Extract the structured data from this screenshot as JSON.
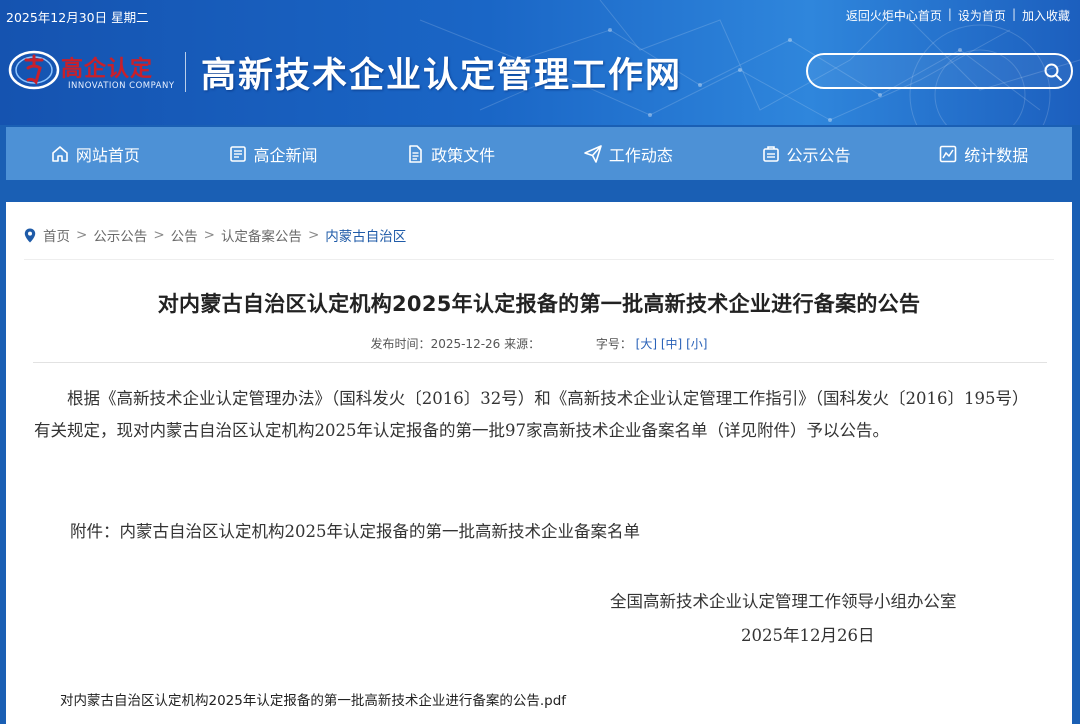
{
  "topbar": {
    "date": "2025年12月30日 星期二",
    "links": [
      "返回火炬中心首页",
      "设为首页",
      "加入收藏"
    ]
  },
  "logo": {
    "cn": "高企认定",
    "en": "INNOVATION COMPANY"
  },
  "site_title": "高新技术企业认定管理工作网",
  "search": {
    "placeholder": "",
    "value": ""
  },
  "nav": [
    {
      "label": "网站首页",
      "icon": "home-icon"
    },
    {
      "label": "高企新闻",
      "icon": "news-icon"
    },
    {
      "label": "政策文件",
      "icon": "document-icon"
    },
    {
      "label": "工作动态",
      "icon": "paper-plane-icon"
    },
    {
      "label": "公示公告",
      "icon": "announcement-icon"
    },
    {
      "label": "统计数据",
      "icon": "chart-icon"
    }
  ],
  "breadcrumb": [
    "首页",
    "公示公告",
    "公告",
    "认定备案公告",
    "内蒙古自治区"
  ],
  "article": {
    "title": "对内蒙古自治区认定机构2025年认定报备的第一批高新技术企业进行备案的公告",
    "meta_publish_label": "发布时间：",
    "meta_publish_date": "2025-12-26",
    "meta_source_label": "来源：",
    "meta_font_label": "字号：",
    "font_sizes": [
      "[大]",
      "[中]",
      "[小]"
    ],
    "paragraph": "根据《高新技术企业认定管理办法》（国科发火〔2016〕32号）和《高新技术企业认定管理工作指引》（国科发火〔2016〕195号）有关规定，现对内蒙古自治区认定机构2025年认定报备的第一批97家高新技术企业备案名单（详见附件）予以公告。",
    "attachment": "附件：内蒙古自治区认定机构2025年认定报备的第一批高新技术企业备案名单",
    "signer": "全国高新技术企业认定管理工作领导小组办公室",
    "sign_date": "2025年12月26日",
    "pdf": "对内蒙古自治区认定机构2025年认定报备的第一批高新技术企业进行备案的公告.pdf"
  },
  "colors": {
    "header_blue": "#1a66c6",
    "nav_blue": "#4d91d6",
    "logo_red": "#c8202b",
    "link_blue": "#2a62b8"
  }
}
